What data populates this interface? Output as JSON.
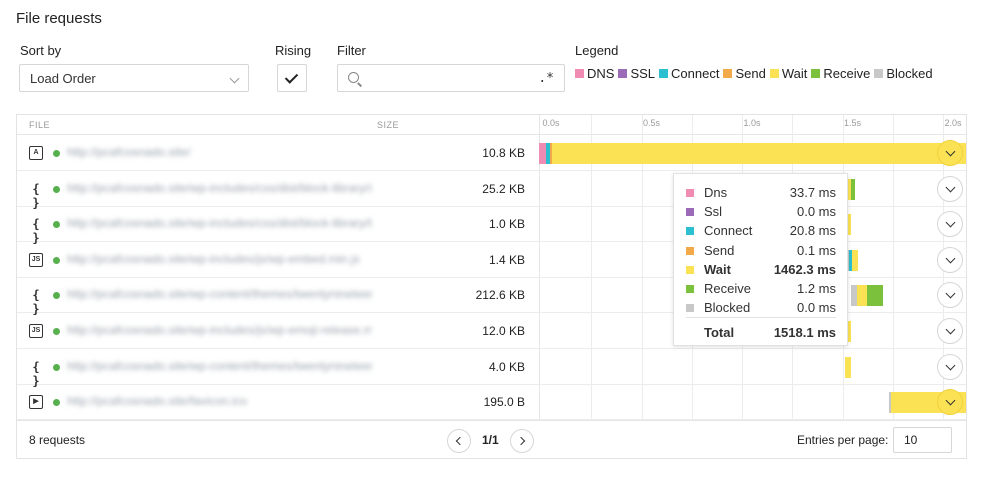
{
  "title": "File requests",
  "controls": {
    "sort_label": "Sort by",
    "sort_value": "Load Order",
    "rising_label": "Rising",
    "filter_label": "Filter",
    "filter_value": "",
    "filter_regex": ".*",
    "legend_label": "Legend"
  },
  "legend": [
    {
      "label": "DNS",
      "color": "#f08bb4"
    },
    {
      "label": "SSL",
      "color": "#9b6bb8"
    },
    {
      "label": "Connect",
      "color": "#2bbfcf"
    },
    {
      "label": "Send",
      "color": "#f2a94a"
    },
    {
      "label": "Wait",
      "color": "#fbe255"
    },
    {
      "label": "Receive",
      "color": "#7cc13c"
    },
    {
      "label": "Blocked",
      "color": "#c8c8c8"
    }
  ],
  "table": {
    "col_file": "FILE",
    "col_size": "SIZE",
    "axis_ticks": [
      "0.0s",
      "0.5s",
      "1.0s",
      "1.5s",
      "2.0s"
    ],
    "rows": [
      {
        "icon": "document-icon",
        "url": "http://pcafcosnado.site/",
        "size": "10.8 KB",
        "bar": {
          "start": 0.0,
          "dns": 0.0337,
          "ssl": 0.0,
          "connect": 0.0208,
          "send": 0.0001,
          "wait": 1.4623,
          "receive": 0.0012,
          "blocked": 0.0,
          "extends": true
        }
      },
      {
        "icon": "css-braces-icon",
        "url": "http://pcafcosnado.site/wp-includes/css/dist/block-library/style.min.css",
        "size": "25.2 KB",
        "bar": {
          "start": 1.5,
          "wait": 0.05,
          "receive": 0.02,
          "blocked": 0.0
        }
      },
      {
        "icon": "css-braces-icon",
        "url": "http://pcafcosnado.site/wp-includes/css/dist/block-library/theme.min.css",
        "size": "1.0 KB",
        "bar": {
          "start": 1.52,
          "wait": 0.03,
          "receive": 0.0,
          "blocked": 0.0
        }
      },
      {
        "icon": "js-file-icon",
        "url": "http://pcafcosnado.site/wp-includes/js/wp-embed.min.js",
        "size": "1.4 KB",
        "bar": {
          "start": 1.53,
          "blocked": 0.01,
          "connect": 0.015,
          "wait": 0.03
        }
      },
      {
        "icon": "css-braces-icon",
        "url": "http://pcafcosnado.site/wp-content/themes/twentynineteen/style.css",
        "size": "212.6 KB",
        "bar": {
          "start": 1.55,
          "wait": 0.05,
          "receive": 0.08,
          "blocked": 0.03
        }
      },
      {
        "icon": "js-file-icon",
        "url": "http://pcafcosnado.site/wp-includes/js/wp-emoji-release.min.js",
        "size": "12.0 KB",
        "bar": {
          "start": 1.52,
          "wait": 0.03,
          "receive": 0.0,
          "blocked": 0.0
        }
      },
      {
        "icon": "css-braces-icon",
        "url": "http://pcafcosnado.site/wp-content/themes/twentynineteen/print.css",
        "size": "4.0 KB",
        "bar": {
          "start": 1.52,
          "wait": 0.03,
          "receive": 0.0,
          "blocked": 0.0
        }
      },
      {
        "icon": "media-icon",
        "url": "http://pcafcosnado.site/favicon.ico",
        "size": "195.0 B",
        "bar": {
          "start": 1.74,
          "blocked": 0.005,
          "wait": 0.4,
          "extends": true
        }
      }
    ]
  },
  "tooltip": {
    "rows": [
      {
        "label": "Dns",
        "value": "33.7 ms",
        "color": "#f08bb4"
      },
      {
        "label": "Ssl",
        "value": "0.0 ms",
        "color": "#9b6bb8"
      },
      {
        "label": "Connect",
        "value": "20.8 ms",
        "color": "#2bbfcf"
      },
      {
        "label": "Send",
        "value": "0.1 ms",
        "color": "#f2a94a"
      },
      {
        "label": "Wait",
        "value": "1462.3 ms",
        "color": "#fbe255"
      },
      {
        "label": "Receive",
        "value": "1.2 ms",
        "color": "#7cc13c"
      },
      {
        "label": "Blocked",
        "value": "0.0 ms",
        "color": "#c8c8c8"
      }
    ],
    "total_label": "Total",
    "total_value": "1518.1 ms"
  },
  "footer": {
    "count": "8 requests",
    "page": "1/1",
    "entries_label": "Entries per page:",
    "entries_value": "10"
  }
}
